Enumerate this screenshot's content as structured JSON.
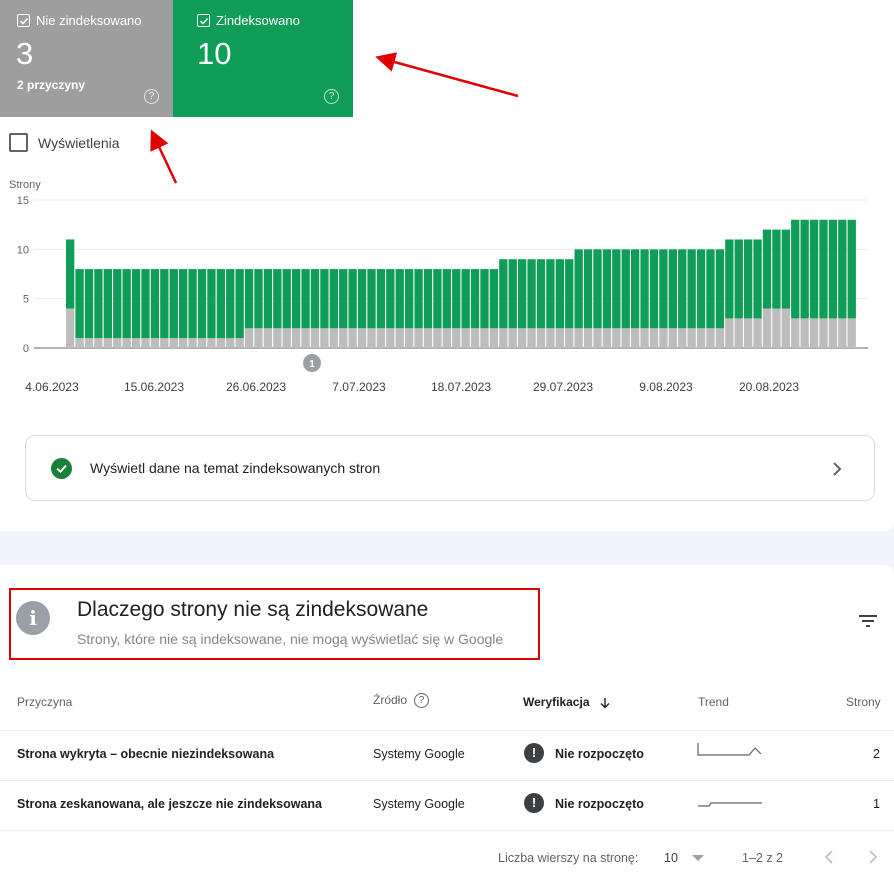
{
  "tiles": {
    "not_indexed": {
      "label": "Nie zindeksowano",
      "value": "3",
      "sub": "2 przyczyny",
      "color": "#9e9e9e",
      "checked": true
    },
    "indexed": {
      "label": "Zindeksowano",
      "value": "10",
      "color": "#0f9d58",
      "checked": true
    }
  },
  "impressions_label": "Wyświetlenia",
  "chart_data": {
    "type": "bar",
    "stacked": true,
    "ylabel": "Strony",
    "ylim": [
      0,
      15
    ],
    "yticks": [
      "15",
      "10",
      "5",
      "0"
    ],
    "xticks": [
      "4.06.2023",
      "15.06.2023",
      "26.06.2023",
      "7.07.2023",
      "18.07.2023",
      "29.07.2023",
      "9.08.2023",
      "20.08.2023"
    ],
    "annotation": "1",
    "series": [
      {
        "name": "Nie zindeksowano",
        "color": "#bdbdbd",
        "values": [
          4,
          1,
          1,
          1,
          1,
          1,
          1,
          1,
          1,
          1,
          1,
          1,
          1,
          1,
          1,
          1,
          1,
          1,
          1,
          2,
          2,
          2,
          2,
          2,
          2,
          2,
          2,
          2,
          2,
          2,
          2,
          2,
          2,
          2,
          2,
          2,
          2,
          2,
          2,
          2,
          2,
          2,
          2,
          2,
          2,
          2,
          2,
          2,
          2,
          2,
          2,
          2,
          2,
          2,
          2,
          2,
          2,
          2,
          2,
          2,
          2,
          2,
          2,
          2,
          2,
          2,
          2,
          2,
          2,
          2,
          3,
          3,
          3,
          3,
          4,
          4,
          4,
          3,
          3,
          3,
          3,
          3,
          3,
          3
        ]
      },
      {
        "name": "Zindeksowano",
        "color": "#0f9d58",
        "values": [
          7,
          7,
          7,
          7,
          7,
          7,
          7,
          7,
          7,
          7,
          7,
          7,
          7,
          7,
          7,
          7,
          7,
          7,
          7,
          6,
          6,
          6,
          6,
          6,
          6,
          6,
          6,
          6,
          6,
          6,
          6,
          6,
          6,
          6,
          6,
          6,
          6,
          6,
          6,
          6,
          6,
          6,
          6,
          6,
          6,
          6,
          7,
          7,
          7,
          7,
          7,
          7,
          7,
          7,
          8,
          8,
          8,
          8,
          8,
          8,
          8,
          8,
          8,
          8,
          8,
          8,
          8,
          8,
          8,
          8,
          8,
          8,
          8,
          8,
          8,
          8,
          8,
          10,
          10,
          10,
          10,
          10,
          10,
          10
        ]
      }
    ]
  },
  "panel_link": {
    "text": "Wyświetl dane na temat zindeksowanych stron"
  },
  "issues": {
    "title": "Dlaczego strony nie są zindeksowane",
    "subtitle": "Strony, które nie są indeksowane, nie mogą wyświetlać się w Google",
    "columns": {
      "reason": "Przyczyna",
      "source": "Źródło",
      "validation": "Weryfikacja",
      "trend": "Trend",
      "pages": "Strony"
    },
    "rows": [
      {
        "reason": "Strona wykryta – obecnie niezindeksowana",
        "source": "Systemy Google",
        "validation": "Nie rozpoczęto",
        "pages": "2"
      },
      {
        "reason": "Strona zeskanowana, ale jeszcze nie zindeksowana",
        "source": "Systemy Google",
        "validation": "Nie rozpoczęto",
        "pages": "1"
      }
    ],
    "footer": {
      "rows_label": "Liczba wierszy na stronę:",
      "rows_value": "10",
      "range": "1–2 z 2"
    }
  },
  "colors": {
    "indexed": "#0f9d58",
    "not_indexed": "#9e9e9e",
    "annotation_red": "#e00000"
  }
}
